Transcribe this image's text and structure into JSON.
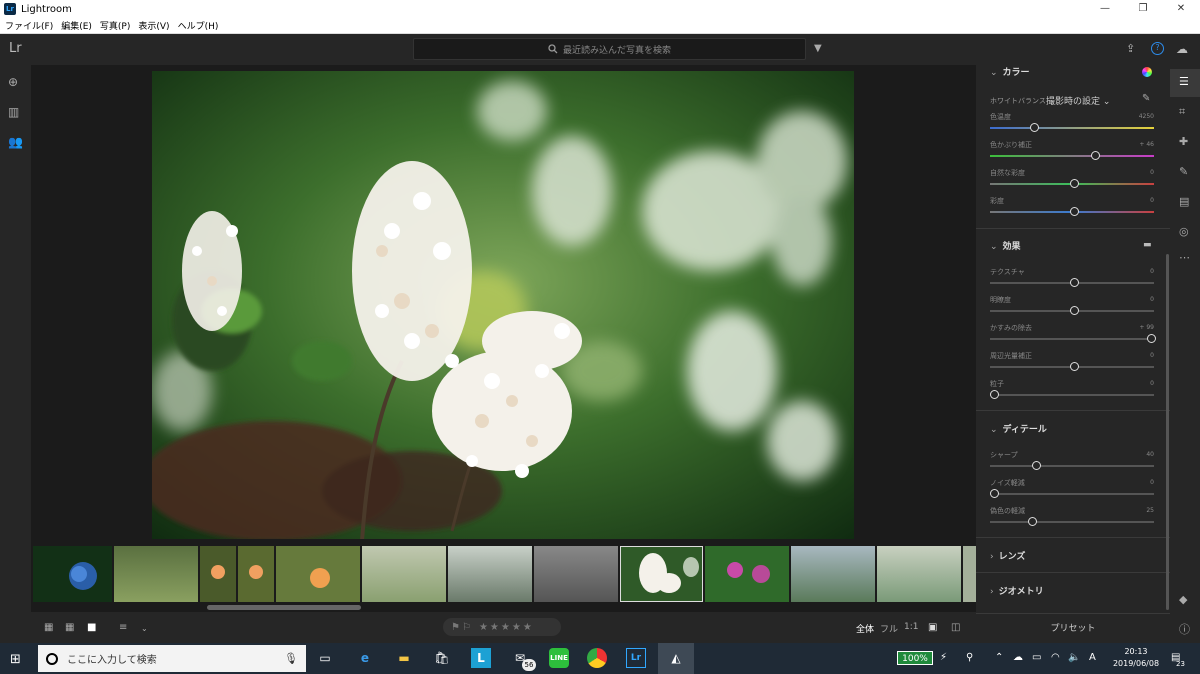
{
  "window": {
    "title": "Lightroom",
    "app_icon_text": "Lr",
    "controls": [
      "—",
      "❐",
      "✕"
    ]
  },
  "menu": [
    "ファイル(F)",
    "編集(E)",
    "写真(P)",
    "表示(V)",
    "ヘルプ(H)"
  ],
  "header": {
    "logo": "Lr",
    "search_placeholder": "最近読み込んだ写真を検索"
  },
  "filmstrip": {
    "thumbnails": [
      {
        "name": "blue-hydrangea",
        "color": "#2a5ea8"
      },
      {
        "name": "garden",
        "color": "#6f8a4e"
      },
      {
        "name": "orange-flower-a",
        "color": "#8a6a3a"
      },
      {
        "name": "orange-flower-b",
        "color": "#7a7a3a"
      },
      {
        "name": "orange-poppy",
        "color": "#5d7a3c"
      },
      {
        "name": "pastel-flowers",
        "color": "#a3b28a"
      },
      {
        "name": "white-blooms",
        "color": "#9aa89a"
      },
      {
        "name": "stone-path",
        "color": "#707070"
      },
      {
        "name": "oakleaf-hydrangea",
        "color": "#3c6a2f",
        "selected": true
      },
      {
        "name": "purple-flowers",
        "color": "#3f7a37"
      },
      {
        "name": "hydrangea-field",
        "color": "#6b8a8a"
      },
      {
        "name": "hydrangea-field-2",
        "color": "#8fa088"
      },
      {
        "name": "partial",
        "color": "#a4b09a"
      }
    ]
  },
  "bottombar": {
    "zoom_options": [
      "全体",
      "フル",
      "1:1"
    ],
    "stars": [
      "★",
      "★",
      "★",
      "★",
      "★"
    ]
  },
  "panel": {
    "color": {
      "heading": "カラー",
      "wb_label": "ホワイトバランス",
      "wb_value": "撮影時の設定",
      "sliders": [
        {
          "label": "色温度",
          "value": "4250",
          "pos": 0.25
        },
        {
          "label": "色かぶり補正",
          "value": "+ 46",
          "pos": 0.63
        },
        {
          "label": "自然な彩度",
          "value": "0",
          "pos": 0.5
        },
        {
          "label": "彩度",
          "value": "0",
          "pos": 0.5
        }
      ]
    },
    "effects": {
      "heading": "効果",
      "sliders": [
        {
          "label": "テクスチャ",
          "value": "0",
          "pos": 0.5
        },
        {
          "label": "明瞭度",
          "value": "0",
          "pos": 0.5
        },
        {
          "label": "かすみの除去",
          "value": "+ 99",
          "pos": 0.98
        },
        {
          "label": "周辺光量補正",
          "value": "0",
          "pos": 0.5
        },
        {
          "label": "粒子",
          "value": "0",
          "pos": 0.0
        }
      ]
    },
    "detail": {
      "heading": "ディテール",
      "sliders": [
        {
          "label": "シャープ",
          "value": "40",
          "pos": 0.26
        },
        {
          "label": "ノイズ軽減",
          "value": "0",
          "pos": 0.0
        },
        {
          "label": "偽色の軽減",
          "value": "25",
          "pos": 0.24
        }
      ]
    },
    "lens": {
      "heading": "レンズ"
    },
    "geometry": {
      "heading": "ジオメトリ"
    },
    "preset_button": "プリセット"
  },
  "taskbar": {
    "search_placeholder": "ここに入力して検索",
    "mail_badge": "56",
    "battery": "100%",
    "ime": "A",
    "time": "20:13",
    "date": "2019/06/08",
    "notifications": "23"
  }
}
